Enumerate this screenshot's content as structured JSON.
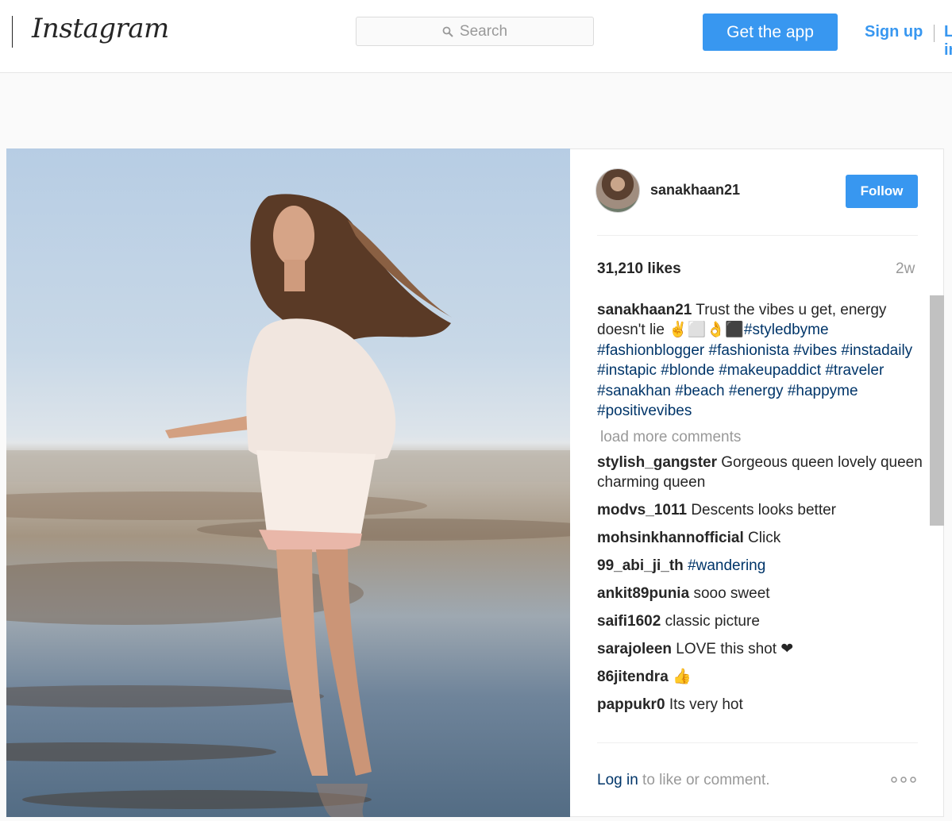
{
  "header": {
    "logo": "Instagram",
    "search_placeholder": "Search",
    "get_app_label": "Get the app",
    "signup_label": "Sign up",
    "login_label": "Log in"
  },
  "post": {
    "username": "sanakhaan21",
    "follow_label": "Follow",
    "likes": "31,210 likes",
    "time_ago": "2w",
    "caption": {
      "username": "sanakhaan21",
      "text": " Trust the vibes u get, energy doesn't lie ✌⬜👌⬛",
      "hashtags": [
        "#styledbyme",
        "#fashionblogger",
        "#fashionista",
        "#vibes",
        "#instadaily",
        "#instapic",
        "#blonde",
        "#makeupaddict",
        "#traveler",
        "#sanakhan",
        "#beach",
        "#energy",
        "#happyme",
        "#positivevibes"
      ]
    },
    "load_more_label": "load more comments",
    "comments": [
      {
        "user": "stylish_gangster",
        "text": "Gorgeous queen lovely queen charming queen"
      },
      {
        "user": "modvs_1011",
        "text": "Descents looks better"
      },
      {
        "user": "mohsinkhannofficial",
        "text": "Click"
      },
      {
        "user": "99_abi_ji_th",
        "tag": "#wandering"
      },
      {
        "user": "ankit89punia",
        "text": "sooo sweet"
      },
      {
        "user": "saifi1602",
        "text": "classic picture"
      },
      {
        "user": "sarajoleen",
        "text": "LOVE this shot ❤"
      },
      {
        "user": "86jitendra",
        "text": "👍"
      },
      {
        "user": "pappukr0",
        "text": "Its very hot"
      }
    ],
    "login_prompt": {
      "link": "Log in",
      "text": " to like or comment."
    }
  },
  "icons": [
    "search-icon",
    "more-options-icon"
  ],
  "colors": {
    "accent": "#3897f0",
    "hashtag": "#003569",
    "muted": "#999999",
    "text": "#262626"
  }
}
